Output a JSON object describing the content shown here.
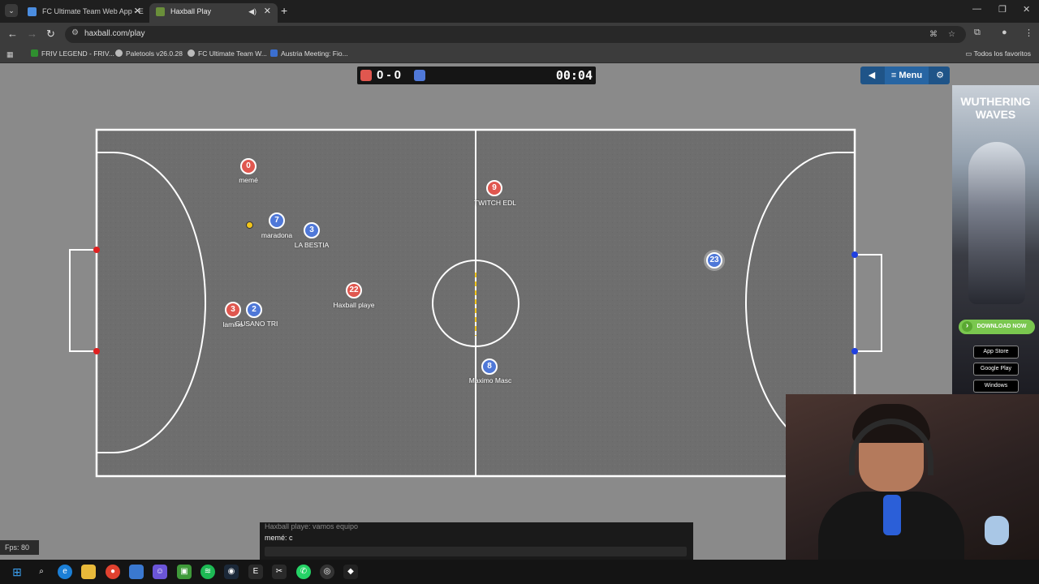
{
  "browser": {
    "tabs": [
      {
        "label": "FC Ultimate Team Web App - E",
        "active": false
      },
      {
        "label": "Haxball Play",
        "active": true
      }
    ],
    "new_tab_icon": "plus-icon",
    "url": "haxball.com/play",
    "bookmarks": [
      {
        "label": "FRIV LEGEND - FRIV...",
        "color": "#2f8f2f"
      },
      {
        "label": "Paletools v26.0.28",
        "color": "#bbbbbb"
      },
      {
        "label": "FC Ultimate Team W...",
        "color": "#bbbbbb"
      },
      {
        "label": "Austria Meeting: Fio...",
        "color": "#3b6fd0"
      }
    ],
    "all_bookmarks": "Todos los favoritos"
  },
  "game": {
    "score": "0 - 0",
    "time": "00:04",
    "red_color": "#e0574f",
    "blue_color": "#4f78d8",
    "menu_label": "Menu",
    "players": [
      {
        "number": "0",
        "name": "memé",
        "team": "red"
      },
      {
        "number": "9",
        "name": "TWITCH EDL",
        "team": "red"
      },
      {
        "number": "7",
        "name": "maradona",
        "team": "blue"
      },
      {
        "number": "3",
        "name": "LA BESTIA",
        "team": "blue"
      },
      {
        "number": "22",
        "name": "Haxball playe",
        "team": "red"
      },
      {
        "number": "3",
        "name": "lamine",
        "team": "red"
      },
      {
        "number": "2",
        "name": "GUSANO TRI",
        "team": "blue"
      },
      {
        "number": "8",
        "name": "Maximo Masc",
        "team": "blue"
      },
      {
        "number": "23",
        "name": "",
        "team": "blue"
      }
    ],
    "chat": [
      {
        "text": "Haxball playe: vamos equipo"
      },
      {
        "text": "memé: c"
      }
    ],
    "fps": "Fps: 80"
  },
  "ad": {
    "title": "WUTHERING WAVES",
    "download": "DOWNLOAD NOW",
    "stores": [
      "App Store",
      "Google Play",
      "Windows"
    ]
  }
}
